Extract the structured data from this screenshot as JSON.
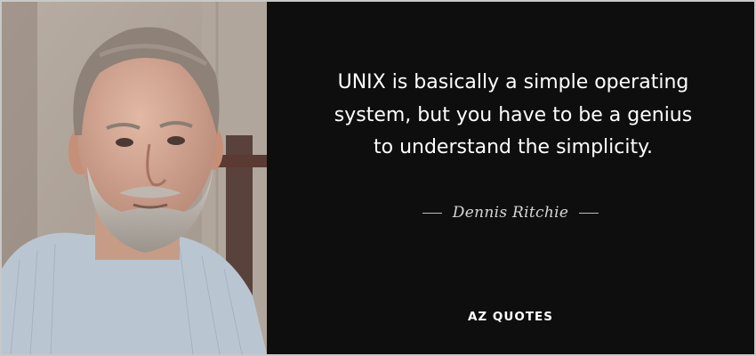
{
  "quote": {
    "lines": [
      "UNIX is basically a simple operating",
      "system, but you have to be a genius",
      "to understand the simplicity."
    ],
    "author": "Dennis Ritchie"
  },
  "brand": {
    "logo_text": "AZ QUOTES"
  },
  "colors": {
    "background": "#0f0e0e",
    "text": "#ffffff",
    "author": "#d6d6d6"
  }
}
